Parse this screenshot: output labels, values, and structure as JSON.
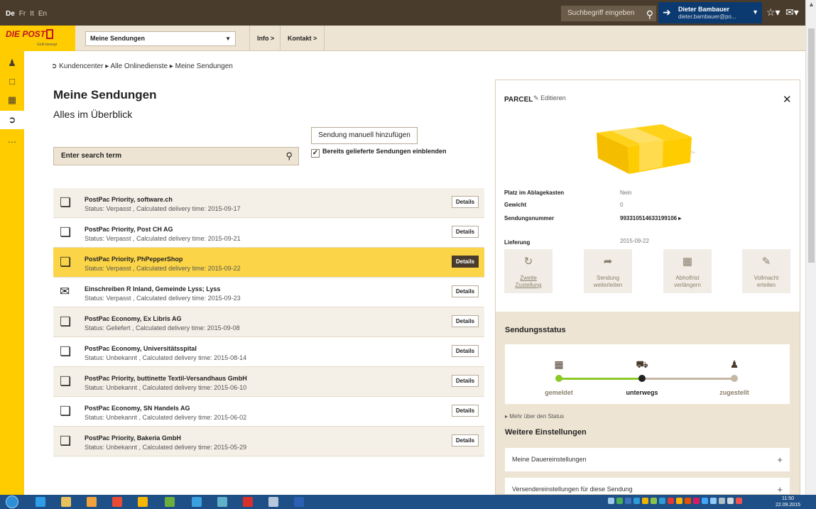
{
  "topbar": {
    "languages": [
      "De",
      "Fr",
      "It",
      "En"
    ],
    "search_placeholder": "Suchbegriff eingeben",
    "user_name": "Dieter Bambauer",
    "user_email": "dieter.bambauer@po..."
  },
  "navbar": {
    "logo_text": "DIE POST",
    "logo_slogan": "Gelb bewegt",
    "select_value": "Meine Sendungen",
    "info_label": "Info >",
    "contact_label": "Kontakt >"
  },
  "main": {
    "breadcrumb": "Kundencenter  ▸  Alle Onlinedienste  ▸  Meine Sendungen",
    "title": "Meine Sendungen",
    "subtitle": "Alles im Überblick",
    "add_button": "Sendung manuell hinzufügen",
    "show_delivered_label": "Bereits gelieferte Sendungen einblenden",
    "search_placeholder": "Enter search term",
    "details_label": "Details",
    "shipments": [
      {
        "title": "PostPac Priority, software.ch",
        "status": "Status: Verpasst , Calculated delivery time: 2015-09-17"
      },
      {
        "title": "PostPac Priority, Post CH AG",
        "status": "Status: Verpasst , Calculated delivery time: 2015-09-21"
      },
      {
        "title": "PostPac Priority, PhPepperShop",
        "status": "Status: Verpasst , Calculated delivery time: 2015-09-22"
      },
      {
        "title": "Einschreiben R Inland, Gemeinde Lyss; Lyss",
        "status": "Status: Verpasst , Calculated delivery time: 2015-09-23"
      },
      {
        "title": "PostPac Economy, Ex Libris AG",
        "status": "Status: Geliefert , Calculated delivery time: 2015-09-08"
      },
      {
        "title": "PostPac Economy, Universitätsspital",
        "status": "Status: Unbekannt , Calculated delivery time: 2015-08-14"
      },
      {
        "title": "PostPac Priority, buttinette Textil-Versandhaus GmbH",
        "status": "Status: Unbekannt , Calculated delivery time: 2015-06-10"
      },
      {
        "title": "PostPac Economy, SN Handels AG",
        "status": "Status: Unbekannt , Calculated delivery time: 2015-06-02"
      },
      {
        "title": "PostPac Priority, Bakeria GmbH",
        "status": "Status: Unbekannt , Calculated delivery time: 2015-05-29"
      }
    ]
  },
  "panel": {
    "title": "PARCEL",
    "edit_label": "Editieren",
    "fields": [
      {
        "key": "Platz im Ablagekasten",
        "value": "Nein"
      },
      {
        "key": "Gewicht",
        "value": "0"
      },
      {
        "key": "Sendungsnummer",
        "value": "993310514633199106 ▸"
      },
      {
        "key": "Lieferung",
        "value": "2015-09-22"
      }
    ],
    "actions": [
      {
        "line1": "Zweite",
        "line2": "Zustellung"
      },
      {
        "line1": "Sendung",
        "line2": "weiterleiten"
      },
      {
        "line1": "Abholfrist",
        "line2": "verlängern"
      },
      {
        "line1": "Vollmacht",
        "line2": "erteilen"
      }
    ],
    "status_title": "Sendungsstatus",
    "steps": [
      "gemeldet",
      "unterwegs",
      "zugestellt"
    ],
    "more_status": "▸ Mehr über den Status",
    "settings_title": "Weitere Einstellungen",
    "settings": [
      "Meine Dauereinstellungen",
      "Versendereinstellungen für diese Sendung"
    ]
  },
  "taskbar": {
    "time": "11:50",
    "date": "22.09.2015"
  },
  "colors": {
    "post_yellow": "#ffcc00",
    "brown": "#4a3c2c",
    "beige": "#eee4d3",
    "user_blue": "#0b3a70",
    "status_green": "#8ac926"
  }
}
